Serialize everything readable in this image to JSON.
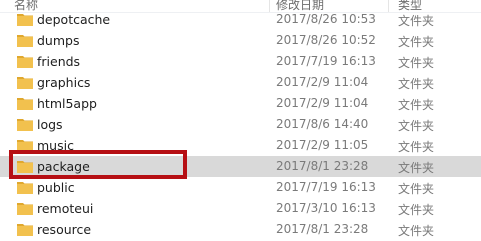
{
  "header": {
    "name_label": "名称",
    "date_label": "修改日期",
    "type_label": "类型"
  },
  "files": [
    {
      "name": "depotcache",
      "date": "2017/8/26 10:53",
      "type": "文件夹",
      "selected": false
    },
    {
      "name": "dumps",
      "date": "2017/8/26 10:52",
      "type": "文件夹",
      "selected": false
    },
    {
      "name": "friends",
      "date": "2017/7/19 16:13",
      "type": "文件夹",
      "selected": false
    },
    {
      "name": "graphics",
      "date": "2017/2/9 11:04",
      "type": "文件夹",
      "selected": false
    },
    {
      "name": "html5app",
      "date": "2017/2/9 11:04",
      "type": "文件夹",
      "selected": false
    },
    {
      "name": "logs",
      "date": "2017/8/6 14:40",
      "type": "文件夹",
      "selected": false
    },
    {
      "name": "music",
      "date": "2017/2/9 11:05",
      "type": "文件夹",
      "selected": false
    },
    {
      "name": "package",
      "date": "2017/8/1 23:28",
      "type": "文件夹",
      "selected": true
    },
    {
      "name": "public",
      "date": "2017/7/19 16:13",
      "type": "文件夹",
      "selected": false
    },
    {
      "name": "remoteui",
      "date": "2017/3/10 16:13",
      "type": "文件夹",
      "selected": false
    },
    {
      "name": "resource",
      "date": "2017/8/1 23:28",
      "type": "文件夹",
      "selected": false
    }
  ],
  "colors": {
    "folder_fill": "#f2c14e",
    "folder_tab": "#e0a82e",
    "selection_bg": "#d9d9d9",
    "highlight_border": "#b60f14"
  },
  "icons": {
    "folder": "folder-icon"
  }
}
